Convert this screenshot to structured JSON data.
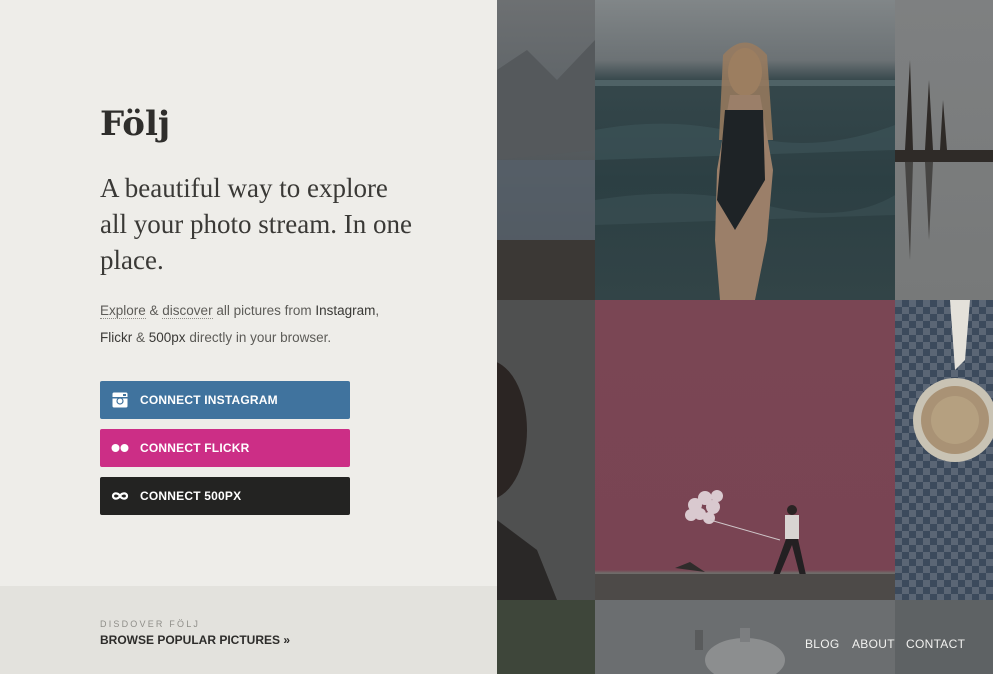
{
  "brand": {
    "name": "Följ"
  },
  "hero": {
    "headline": "A beautiful way to explore all your photo stream. In one place.",
    "intro": {
      "explore": "Explore",
      "amp1": " & ",
      "discover": "discover",
      "all_pictures_from": " all pictures from ",
      "instagram": "Instagram",
      "comma": ",",
      "flickr": "Flickr",
      "amp2": " & ",
      "px500": "500px",
      "directly": " directly in your browser."
    }
  },
  "buttons": {
    "instagram": {
      "label": "CONNECT INSTAGRAM",
      "icon": "instagram-icon",
      "color": "#40739e"
    },
    "flickr": {
      "label": "CONNECT FLICKR",
      "icon": "flickr-icon",
      "color": "#cc2e86"
    },
    "px500": {
      "label": "CONNECT 500PX",
      "icon": "500px-infinity-icon",
      "color": "#232322"
    }
  },
  "footer": {
    "label": "DISDOVER FÖLJ",
    "browse_link": "BROWSE POPULAR PICTURES »"
  },
  "nav": {
    "blog": "BLOG",
    "about": "ABOUT",
    "contact": "CONTACT"
  }
}
